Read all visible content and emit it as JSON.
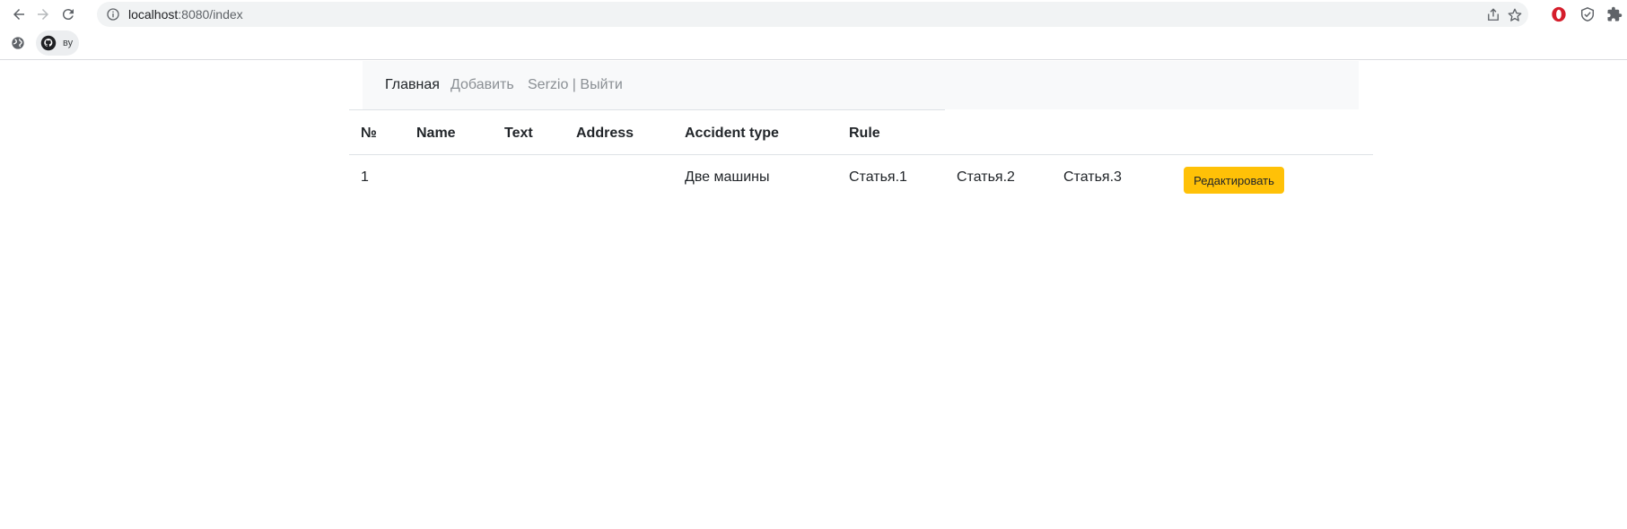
{
  "browser": {
    "url_host": "localhost",
    "url_path": ":8080/index",
    "icons": {
      "back": "arrow-left-icon",
      "forward": "arrow-right-icon",
      "reload": "reload-icon",
      "info": "info-icon",
      "share": "share-icon",
      "bookmark": "star-icon",
      "opera": "opera-icon",
      "shield": "shield-icon",
      "extensions": "puzzle-icon"
    },
    "bookmarks": [
      {
        "icon": "globe-icon",
        "label": ""
      },
      {
        "icon": "github-icon",
        "label": "ву"
      }
    ]
  },
  "nav": {
    "home": "Главная",
    "add": "Добавить",
    "user": "Serzio | Выйти"
  },
  "table": {
    "headers": [
      "№",
      "Name",
      "Text",
      "Address",
      "Accident type",
      "Rule"
    ],
    "rows": [
      {
        "id": "1",
        "name": "",
        "text": "",
        "address": "",
        "accident_type": "Две машины",
        "rules": [
          "Статья.1",
          "Статья.2",
          "Статья.3"
        ],
        "edit_label": "Редактировать"
      }
    ]
  },
  "colors": {
    "navbar_bg": "#f8f9fa",
    "edit_button": "#ffc107",
    "opera_red": "#d51d2b"
  }
}
